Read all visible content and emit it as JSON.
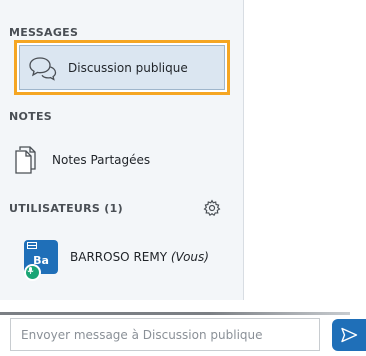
{
  "sidebar": {
    "messages": {
      "title": "MESSAGES",
      "items": [
        {
          "label": "Discussion publique",
          "icon": "chat-bubbles-icon",
          "selected": true
        }
      ]
    },
    "notes": {
      "title": "NOTES",
      "items": [
        {
          "label": "Notes Partagées",
          "icon": "documents-icon"
        }
      ]
    },
    "users": {
      "title": "UTILISATEURS (1)",
      "settings_icon": "gear-icon",
      "items": [
        {
          "initials": "Ba",
          "name": "BARROSO REMY",
          "you_tag": "(Vous)",
          "avatar_color": "#1f6fb8",
          "presence_color": "#1aa575"
        }
      ]
    }
  },
  "compose": {
    "placeholder": "Envoyer message à Discussion publique",
    "value": "",
    "send_icon": "send-icon"
  },
  "colors": {
    "accent": "#1f6fb8",
    "focus_outline": "#f5a623",
    "selected_bg": "#dbe6f1"
  }
}
